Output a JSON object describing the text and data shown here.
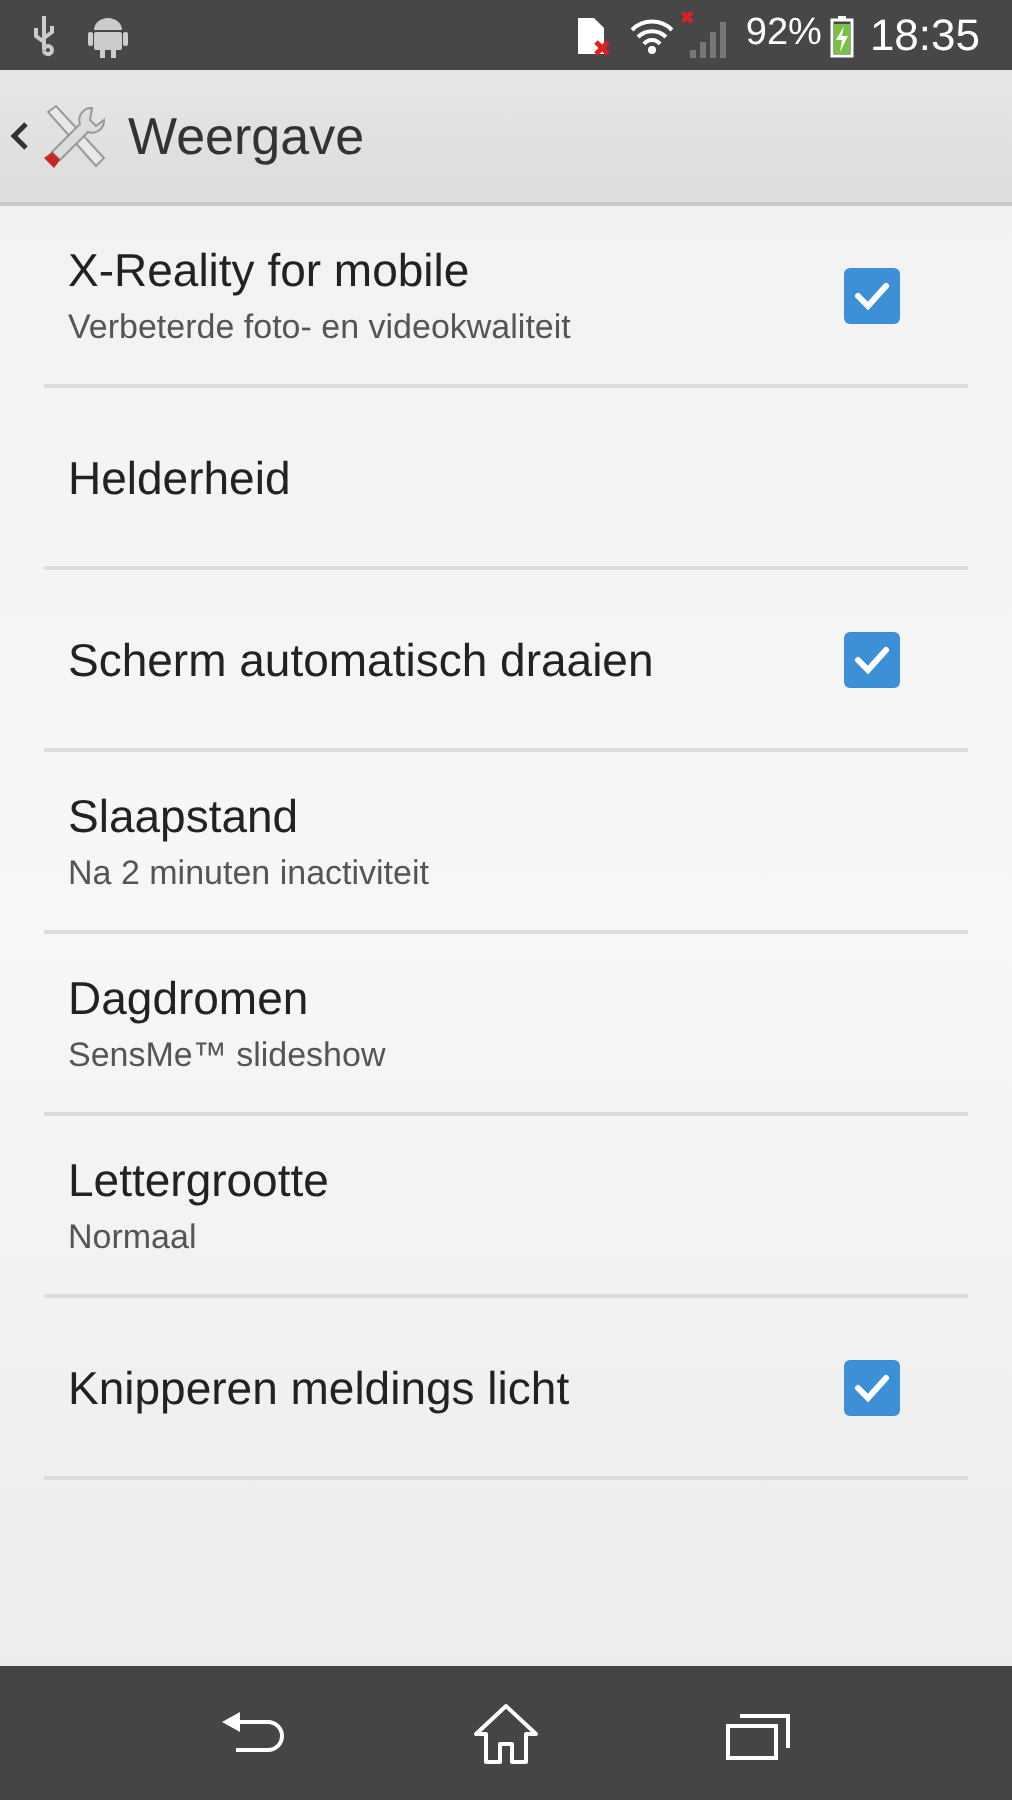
{
  "status_bar": {
    "battery": "92%",
    "time": "18:35"
  },
  "header": {
    "title": "Weergave"
  },
  "settings": [
    {
      "kind": "checkbox",
      "title": "X-Reality for mobile",
      "summary": "Verbeterde foto- en videokwaliteit",
      "checked": true
    },
    {
      "kind": "plain",
      "title": "Helderheid"
    },
    {
      "kind": "checkbox",
      "title": "Scherm automatisch draaien",
      "checked": true
    },
    {
      "kind": "plain",
      "title": "Slaapstand",
      "summary": "Na 2 minuten inactiviteit"
    },
    {
      "kind": "plain",
      "title": "Dagdromen",
      "summary": "SensMe™ slideshow"
    },
    {
      "kind": "plain",
      "title": "Lettergrootte",
      "summary": "Normaal"
    },
    {
      "kind": "checkbox",
      "title": "Knipperen meldings licht",
      "checked": true
    }
  ]
}
